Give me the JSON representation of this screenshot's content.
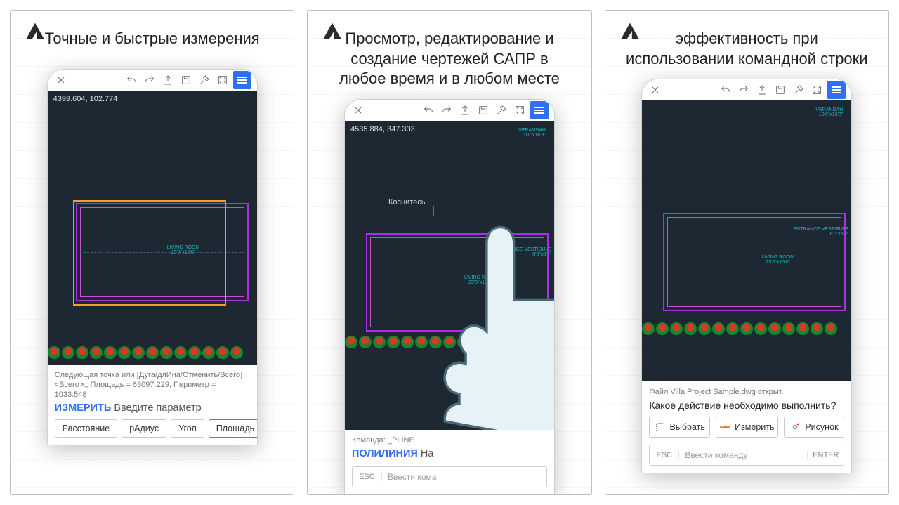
{
  "headlines": {
    "s1": "Точные и быстрые измерения",
    "s2": "Просмотр, редактирование и создание чертежей САПР в любое время и в любом месте",
    "s3": "эффективность при использовании командной строки"
  },
  "coords": {
    "s1": "4399.604, 102.774",
    "s2": "4535.884, 347.303"
  },
  "rooms": {
    "verandah": "VERANDAH",
    "verandah_dim": "10'0\"x16'8\"",
    "living": "LIVING ROOM",
    "living_dim": "25'0\"x15'0\"",
    "entrance": "ENTRANCE VESTIBULE",
    "entrance_dim": "8'0\"x8'0\""
  },
  "touch_label": "Коснитесь",
  "s1_panel": {
    "hint1": "Следующая точка или [Дуга/длИна/Отменить/Всего]",
    "hint2": "<Всего>:; Площадь = 63097.229, Периметр = 1033.548",
    "cmd": "ИЗМЕРИТЬ",
    "rest": "Введите параметр",
    "chips": [
      "Расстояние",
      "рАдиус",
      "Угол",
      "Площадь"
    ]
  },
  "s2_panel": {
    "hint": "Команда: _PLINE",
    "cmd": "ПОЛИЛИНИЯ",
    "rest": "На",
    "esc": "ESC",
    "input_ph": "Ввести кома"
  },
  "s3_panel": {
    "file_hint": "Файл Villa Project Sample.dwg открыт.",
    "question": "Какое действие необходимо выполнить?",
    "btns": [
      "Выбрать",
      "Измерить",
      "Рисунок"
    ],
    "esc": "ESC",
    "input_ph": "Ввести команду",
    "enter": "ENTER"
  }
}
